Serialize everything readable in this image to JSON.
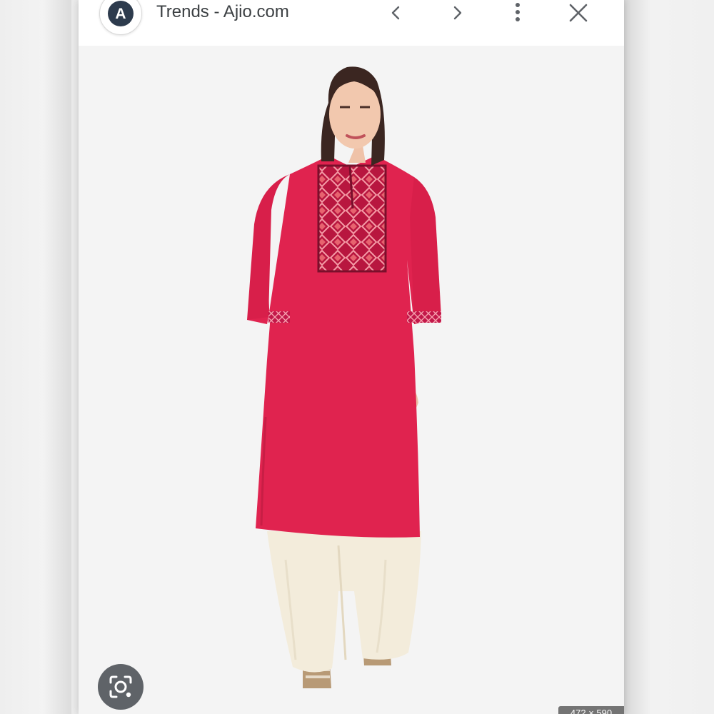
{
  "browser": {
    "title": "Trends - Ajio.com",
    "logo_letter": "A",
    "icons": {
      "back": "chevron-left-icon",
      "forward": "chevron-right-icon",
      "menu": "more-vert-icon",
      "close": "close-icon",
      "lens": "lens-search-icon"
    }
  },
  "image": {
    "dimensions_label": "472 × 590"
  },
  "colors": {
    "kurta": "#e0234f",
    "embroidery": "#c2184a",
    "palazzo": "#f3ecdb",
    "background": "#f4f4f4"
  }
}
